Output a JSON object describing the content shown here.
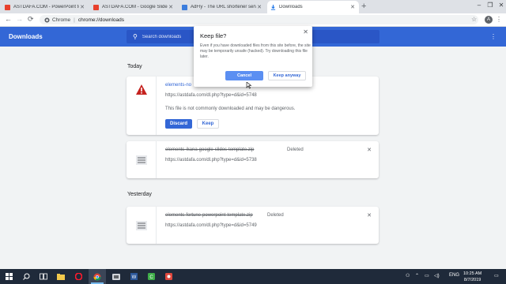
{
  "tabs": [
    {
      "title": "ASTDAFA.COM - PowerPoint tem",
      "favicon": "astdafa-favicon",
      "color": "#e8402c",
      "active": false
    },
    {
      "title": "ASTDAFA.COM - Google Slide Te",
      "favicon": "astdafa-favicon",
      "color": "#e8402c",
      "active": false
    },
    {
      "title": "AdFly - The URL shortener servi",
      "favicon": "adfly-favicon",
      "color": "#3b7ddd",
      "active": false
    },
    {
      "title": "Downloads",
      "favicon": "download-icon",
      "color": "#1a73e8",
      "active": true
    }
  ],
  "toolbar": {
    "site_label": "Chrome",
    "url": "chrome://downloads",
    "avatar_letter": "A"
  },
  "header": {
    "title": "Downloads",
    "search_placeholder": "Search downloads"
  },
  "sections": {
    "today": "Today",
    "yesterday": "Yesterday"
  },
  "downloads": [
    {
      "name": "elements-no",
      "url": "https://astdafa.com/dl.php?type=d&id=5748",
      "warning": "This file is not commonly downloaded and may be dangerous.",
      "discard_label": "Discard",
      "keep_label": "Keep"
    },
    {
      "name": "elements-ikana-google-slides-template.zip",
      "status": "Deleted",
      "url": "https://astdafa.com/dl.php?type=d&id=5738"
    },
    {
      "name": "elements-fortune-powerpoint-template.zip",
      "status": "Deleted",
      "url": "https://astdafa.com/dl.php?type=d&id=5749"
    }
  ],
  "dialog": {
    "title": "Keep file?",
    "body": "Even if you have downloaded files from this site before, the site may be temporarily unsafe (hacked). Try downloading this file later.",
    "cancel_label": "Cancel",
    "keep_anyway_label": "Keep anyway"
  },
  "taskbar": {
    "language": "ENG",
    "time": "10:25 AM",
    "date": "8/7/2019"
  },
  "colors": {
    "accent": "#3367d6",
    "warning": "#c5221f"
  }
}
